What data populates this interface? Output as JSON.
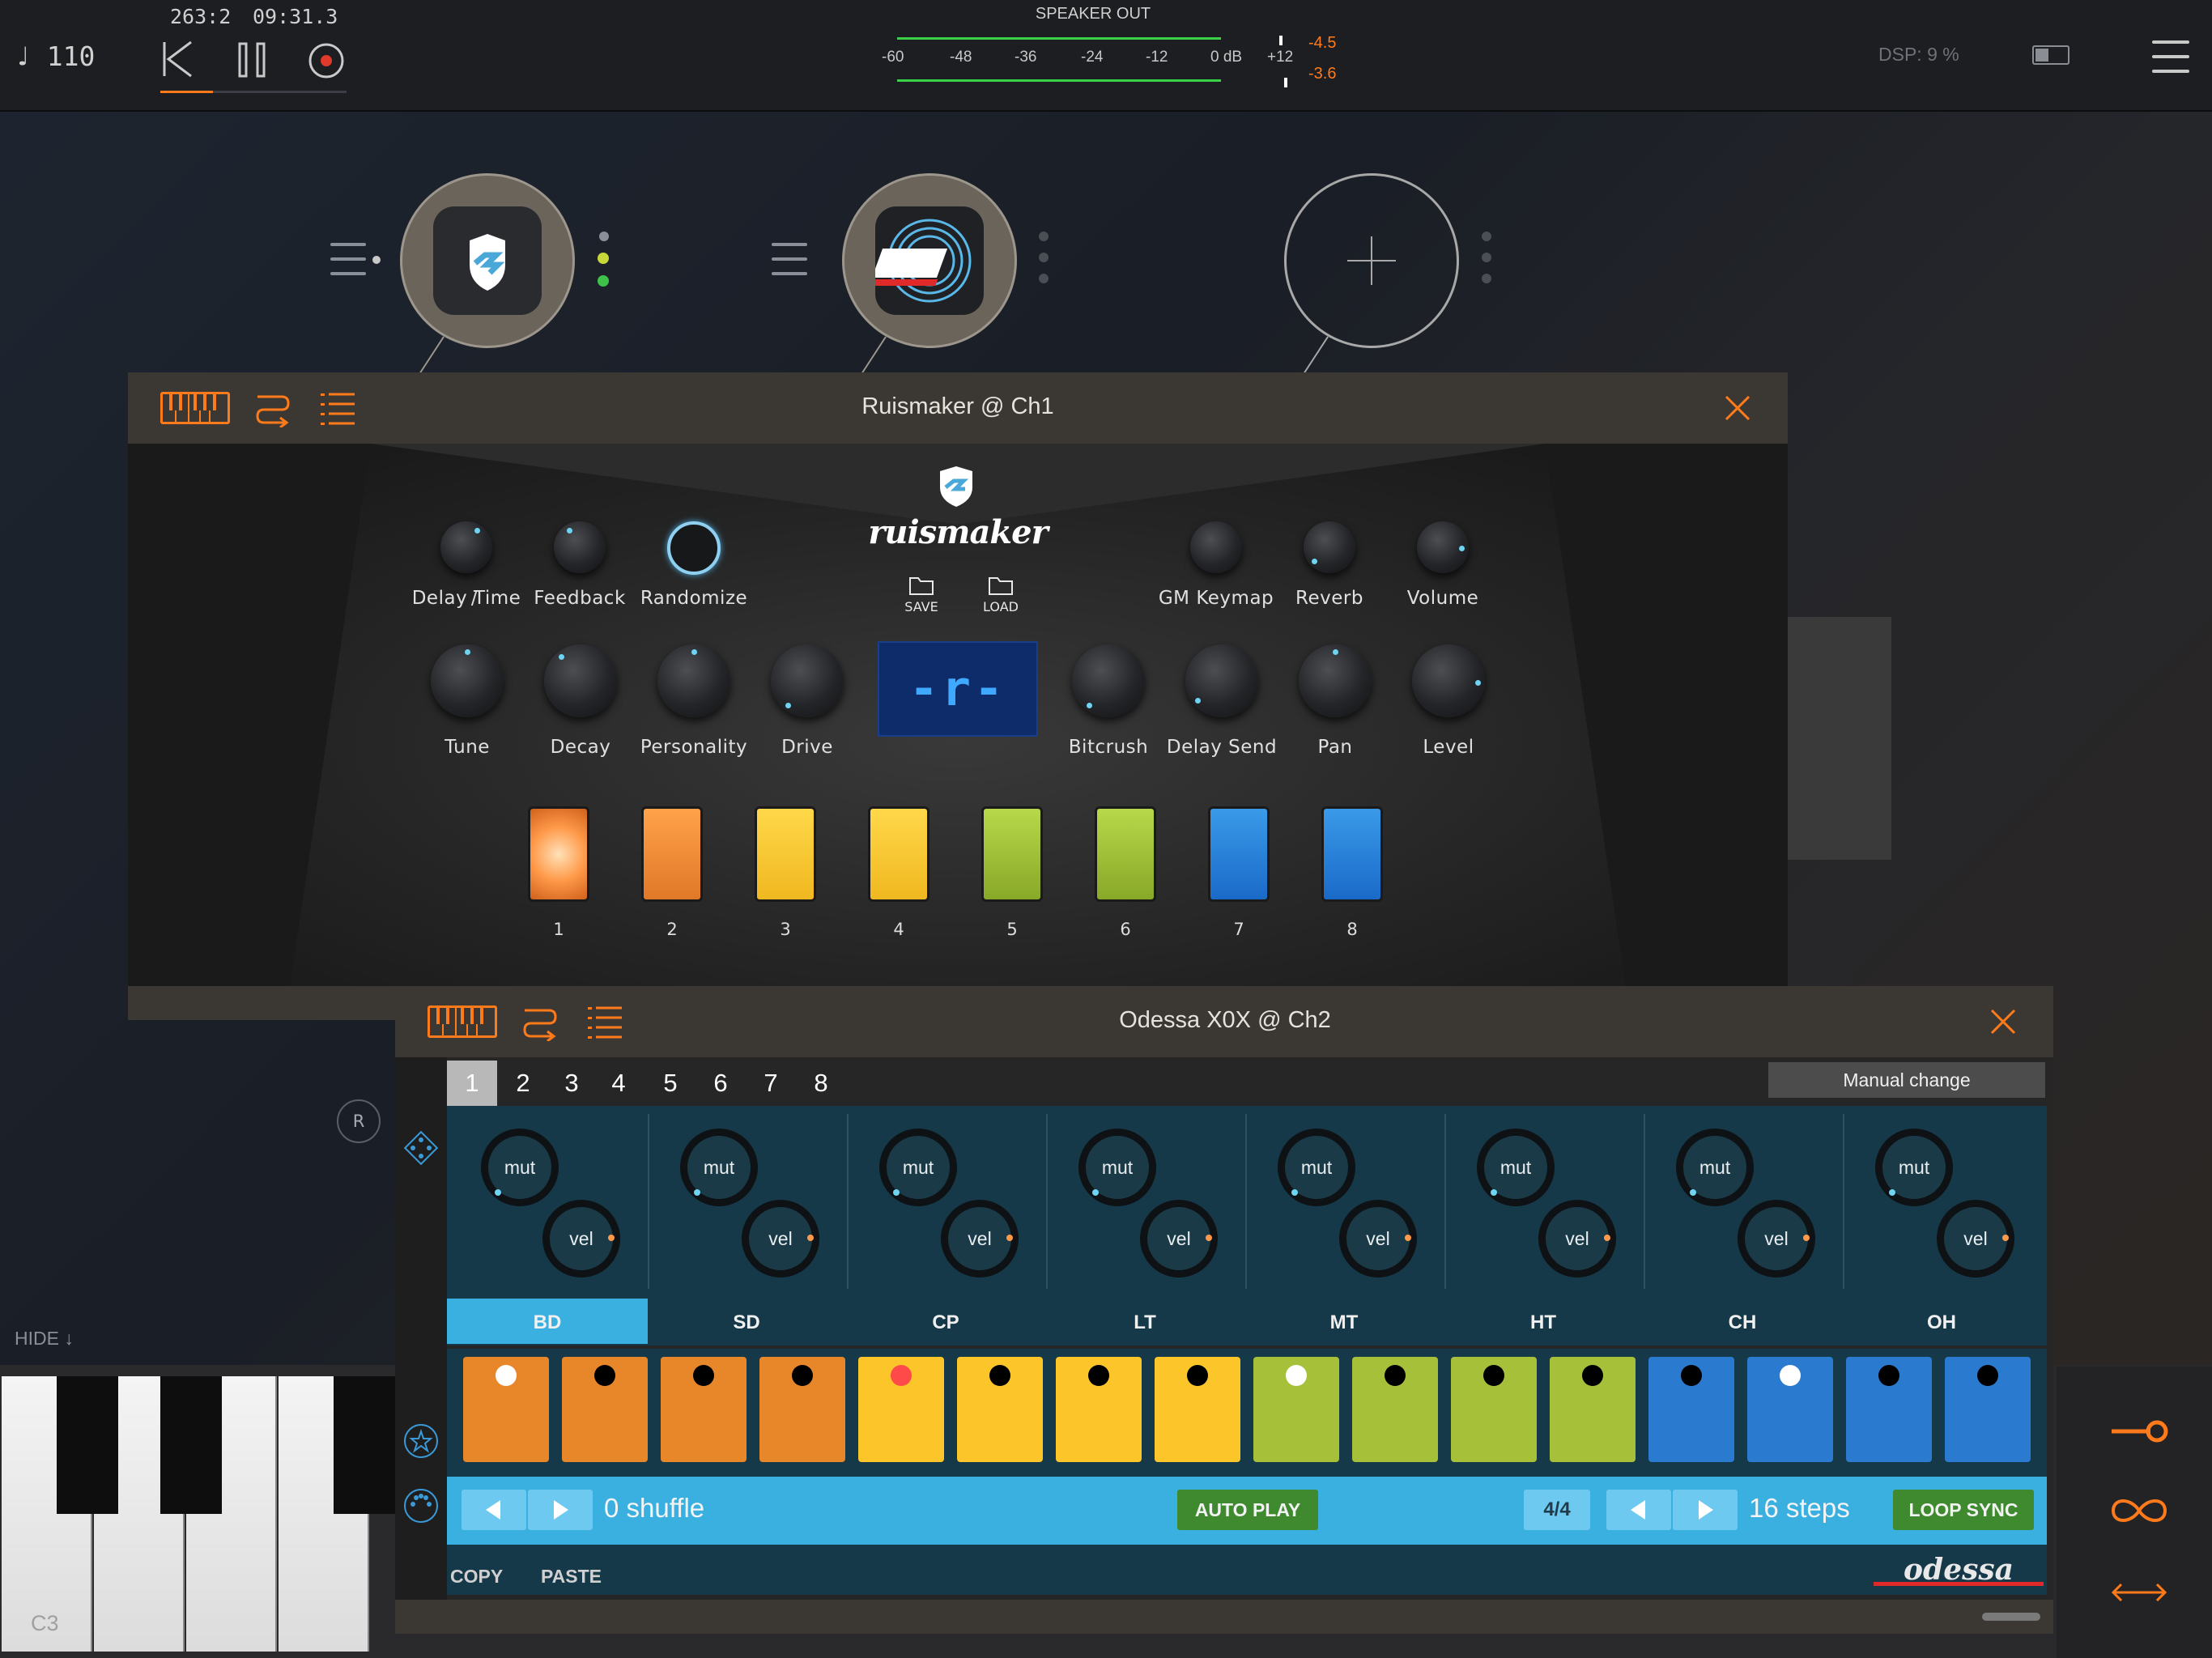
{
  "topbar": {
    "tempo": "♩ 110",
    "position": "263:2",
    "time": "09:31.3",
    "speaker_out": "SPEAKER OUT",
    "meter_scale": [
      "-60",
      "-48",
      "-36",
      "-24",
      "-12",
      "0 dB",
      "+12"
    ],
    "peak_top": "-4.5",
    "peak_bottom": "-3.6",
    "dsp": "DSP:  9 %"
  },
  "colors": {
    "accent": "#ff7a1a",
    "green": "#3f8a2e",
    "bluebar": "#3ab0e0"
  },
  "ruismaker": {
    "title": "Ruismaker @ Ch1",
    "logo": "ruismaker",
    "save": "SAVE",
    "load": "LOAD",
    "display": "-r-",
    "row1": [
      "Delay Time",
      "/",
      "Feedback",
      "Randomize",
      "GM Keymap",
      "Reverb",
      "Volume"
    ],
    "row2": [
      "Tune",
      "Decay",
      "Personality",
      "Drive",
      "Bitcrush",
      "Delay Send",
      "Pan",
      "Level"
    ],
    "pads": [
      "1",
      "2",
      "3",
      "4",
      "5",
      "6",
      "7",
      "8"
    ]
  },
  "odessa": {
    "title": "Odessa X0X @ Ch2",
    "patterns": [
      "1",
      "2",
      "3",
      "4",
      "5",
      "6",
      "7",
      "8"
    ],
    "manual_change": "Manual change",
    "mut": "mut",
    "vel": "vel",
    "channels": [
      "BD",
      "SD",
      "CP",
      "LT",
      "MT",
      "HT",
      "CH",
      "OH"
    ],
    "shuffle": "0 shuffle",
    "auto_play": "AUTO PLAY",
    "meter": "4/4",
    "steps": "16 steps",
    "loop_sync": "LOOP SYNC",
    "copy": "COPY",
    "paste": "PASTE",
    "logo": "odessa"
  },
  "side": {
    "r": "R",
    "hide": "HIDE ↓",
    "key": "C3"
  }
}
